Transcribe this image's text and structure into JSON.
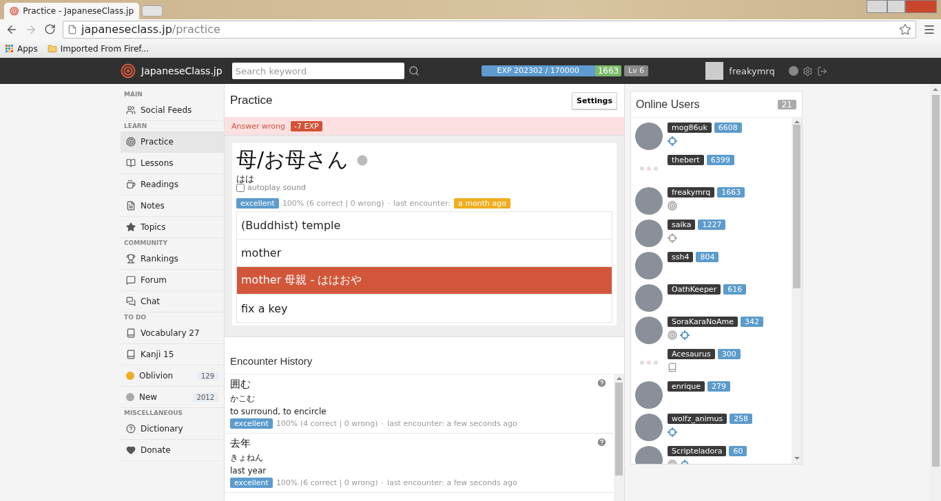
{
  "browser": {
    "tab_title": "Practice - JapaneseClass.jp",
    "url_host": "japaneseclass.jp",
    "url_path": "/practice",
    "bookmarks": [
      "Apps",
      "Imported From Firef..."
    ]
  },
  "navbar": {
    "brand": "JapaneseClass.jp",
    "search": {
      "placeholder": "Search keyword"
    },
    "exp": {
      "label": "EXP 202302 / 170000",
      "points": "1663"
    },
    "rank": "Lv 6",
    "username": "freakymrq"
  },
  "sidebar": [
    {
      "heading": "MAIN",
      "items": [
        {
          "label": "Social Feeds",
          "kind": "icon",
          "selected": false
        }
      ]
    },
    {
      "heading": "LEARN",
      "items": [
        {
          "label": "Practice",
          "kind": "icon",
          "selected": true
        },
        {
          "label": "Lessons",
          "kind": "icon",
          "selected": false
        },
        {
          "label": "Readings",
          "kind": "icon",
          "selected": false
        },
        {
          "label": "Notes",
          "kind": "icon",
          "selected": false
        },
        {
          "label": "Topics",
          "kind": "icon",
          "selected": false
        }
      ]
    },
    {
      "heading": "COMMUNITY",
      "items": [
        {
          "label": "Rankings",
          "kind": "icon",
          "selected": false
        },
        {
          "label": "Forum",
          "kind": "icon",
          "selected": false
        },
        {
          "label": "Chat",
          "kind": "icon",
          "selected": false
        }
      ]
    },
    {
      "heading": "TO DO",
      "items": [
        {
          "label": "Vocabulary 27",
          "kind": "icon",
          "selected": false
        },
        {
          "label": "Kanji 15",
          "kind": "icon",
          "selected": false
        },
        {
          "label": "Oblivion",
          "kind": "dot",
          "color": "#f0ad1e",
          "count": "129",
          "selected": false
        },
        {
          "label": "New",
          "kind": "dot",
          "color": "#aaaaaa",
          "count": "2012",
          "selected": false
        }
      ]
    },
    {
      "heading": "MISCELLANEOUS",
      "items": [
        {
          "label": "Dictionary",
          "kind": "icon",
          "selected": false
        },
        {
          "label": "Donate",
          "kind": "icon",
          "selected": false
        }
      ]
    }
  ],
  "practice": {
    "title": "Practice",
    "settings_button": "Settings",
    "alert": {
      "text": "Answer wrong",
      "badge": "-7 EXP"
    },
    "word": "母/お母さん",
    "reading": "はは",
    "autoplay": {
      "label": "autoplay sound",
      "checked": false
    },
    "grade": "excellent",
    "stats": "100% (6 correct | 0 wrong)",
    "separator": "·",
    "last_label": "last encounter:",
    "last_value": "a month ago",
    "choices": [
      {
        "text": "(Buddhist) temple",
        "highlighted": false
      },
      {
        "text": "mother",
        "highlighted": false
      },
      {
        "text": "mother  母親 - ははおや",
        "highlighted": true
      },
      {
        "text": "fix a key",
        "highlighted": false
      }
    ]
  },
  "history": {
    "title": "Encounter History",
    "entries": [
      {
        "word": "囲む",
        "reading": "かこむ",
        "meaning": "to surround, to encircle",
        "grade": "excellent",
        "stats": "100% (4 correct | 0 wrong)",
        "separator": "·",
        "last": "last encounter: a few seconds ago"
      },
      {
        "word": "去年",
        "reading": "きょねん",
        "meaning": "last year",
        "grade": "excellent",
        "stats": "100% (6 correct | 0 wrong)",
        "separator": "·",
        "last": "last encounter: a few seconds ago"
      }
    ]
  },
  "online_users": {
    "title": "Online Users",
    "count": "21",
    "users": [
      {
        "name": "mog86uk",
        "points": "6608",
        "kind": "photo",
        "badges": [
          {
            "kind": "target"
          }
        ]
      },
      {
        "name": "thebert",
        "points": "6399",
        "kind": "loading"
      },
      {
        "name": "freakymrq",
        "points": "1663",
        "kind": "photo",
        "badges": [
          {
            "kind": "practice"
          }
        ]
      },
      {
        "name": "saika",
        "points": "1227",
        "kind": "photo",
        "badges": [
          {
            "kind": "away"
          }
        ]
      },
      {
        "name": "ssh4",
        "points": "804",
        "kind": "photo"
      },
      {
        "name": "OathKeeper",
        "points": "616",
        "kind": "photo"
      },
      {
        "name": "SoraKaraNoAme",
        "points": "342",
        "kind": "photo",
        "badges": [
          {
            "kind": "practice"
          },
          {
            "kind": "target"
          }
        ]
      },
      {
        "name": "Acesaurus",
        "points": "300",
        "kind": "loading",
        "badges": [
          {
            "kind": "book"
          }
        ]
      },
      {
        "name": "enrique",
        "points": "279",
        "kind": "photo"
      },
      {
        "name": "wolfz_animus",
        "points": "258",
        "kind": "photo",
        "badges": [
          {
            "kind": "target"
          }
        ]
      },
      {
        "name": "Scripteladora",
        "points": "60",
        "kind": "photo",
        "badges": [
          {
            "kind": "practice"
          },
          {
            "kind": "target"
          }
        ]
      }
    ]
  }
}
